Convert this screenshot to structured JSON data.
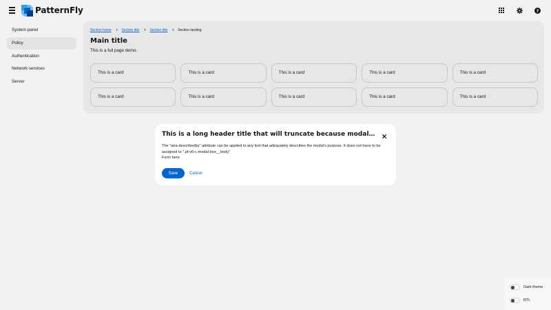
{
  "header": {
    "menu_icon": "hamburger-icon",
    "brand": "PatternFly",
    "tools": [
      {
        "icon": "apps-grid-icon"
      },
      {
        "icon": "gear-icon"
      },
      {
        "icon": "help-icon"
      }
    ]
  },
  "sidebar": {
    "items": [
      {
        "label": "System panel"
      },
      {
        "label": "Policy",
        "active": true
      },
      {
        "label": "Authentication"
      },
      {
        "label": "Network services"
      },
      {
        "label": "Server"
      }
    ]
  },
  "main": {
    "breadcrumb": [
      {
        "label": "Section home"
      },
      {
        "label": "Section title"
      },
      {
        "label": "Section title"
      },
      {
        "label": "Section landing"
      }
    ],
    "title": "Main title",
    "description": "This is a full page demo.",
    "cards": [
      "This is a card",
      "This is a card",
      "This is a card",
      "This is a card",
      "This is a card",
      "This is a card",
      "This is a card",
      "This is a card",
      "This is a card",
      "This is a card"
    ]
  },
  "modal": {
    "title": "This is a long header title that will truncate because modal titles should be very, very short",
    "body": "The \"aria-describedby\" attribute can be applied to any text that adequately describes the modal's purpose. It does not have to be assigned to \".pf-v6-c-modal-box__body\"",
    "form": "Form here",
    "save_label": "Save",
    "cancel_label": "Cancel"
  },
  "theme_switcher": {
    "dark_label": "Dark theme",
    "rtl_label": "RTL"
  },
  "colors": {
    "accent": "#0066cc",
    "background": "#f2f2f2",
    "panel": "#e7e7e7",
    "modal": "#ffffff"
  }
}
